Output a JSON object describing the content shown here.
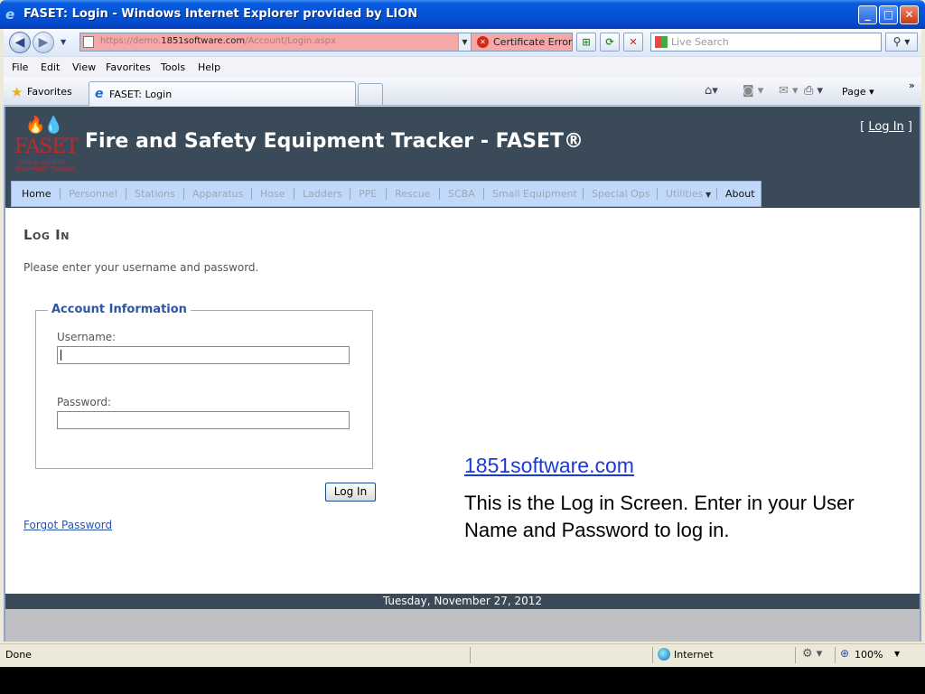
{
  "window": {
    "title": "FASET: Login - Windows Internet Explorer provided by LION",
    "minimize": "_",
    "maximize": "□",
    "close": "✕"
  },
  "address_bar": {
    "url_prefix": "https://demo.",
    "url_domain": "1851software.com",
    "url_path": "/Account/Login.aspx",
    "certificate_error": "Certificate Error",
    "search_placeholder": "Live Search"
  },
  "menu": [
    "File",
    "Edit",
    "View",
    "Favorites",
    "Tools",
    "Help"
  ],
  "tabs": {
    "favorites_label": "Favorites",
    "active_tab": "FASET: Login",
    "page_menu": "Page"
  },
  "site": {
    "logo_text": "FASET",
    "logo_sub1": "FIRE & SAFETY",
    "logo_sub2": "EQUIPMENT TRACKER",
    "title": "Fire and Safety Equipment Tracker - FASET®",
    "login_link": "Log In",
    "login_bracket_open": "[",
    "login_bracket_close": "]"
  },
  "nav": [
    {
      "label": "Home",
      "active": true
    },
    {
      "label": "Personnel",
      "active": false
    },
    {
      "label": "Stations",
      "active": false
    },
    {
      "label": "Apparatus",
      "active": false
    },
    {
      "label": "Hose",
      "active": false
    },
    {
      "label": "Ladders",
      "active": false
    },
    {
      "label": "PPE",
      "active": false
    },
    {
      "label": "Rescue",
      "active": false
    },
    {
      "label": "SCBA",
      "active": false
    },
    {
      "label": "Small Equipment",
      "active": false
    },
    {
      "label": "Special Ops",
      "active": false
    },
    {
      "label": "Utilities",
      "active": false
    },
    {
      "label": "About",
      "active": true
    }
  ],
  "login": {
    "heading": "Log In",
    "instructions": "Please enter your username and password.",
    "legend": "Account Information",
    "username_label": "Username:",
    "username_value": "",
    "password_label": "Password:",
    "password_value": "",
    "button": "Log In",
    "forgot": "Forgot Password"
  },
  "promo": {
    "link": "1851software.com",
    "text": "This is the Log in Screen.  Enter in your User Name and Password to log in."
  },
  "footer": {
    "date": "Tuesday, November 27, 2012"
  },
  "status": {
    "text": "Done",
    "zone": "Internet",
    "zoom": "100%"
  },
  "colors": {
    "header_bg": "#3b4a59",
    "nav_bg": "#c2d8f8",
    "link": "#2a55a8",
    "cert_error_bg": "#f4a8a8"
  }
}
